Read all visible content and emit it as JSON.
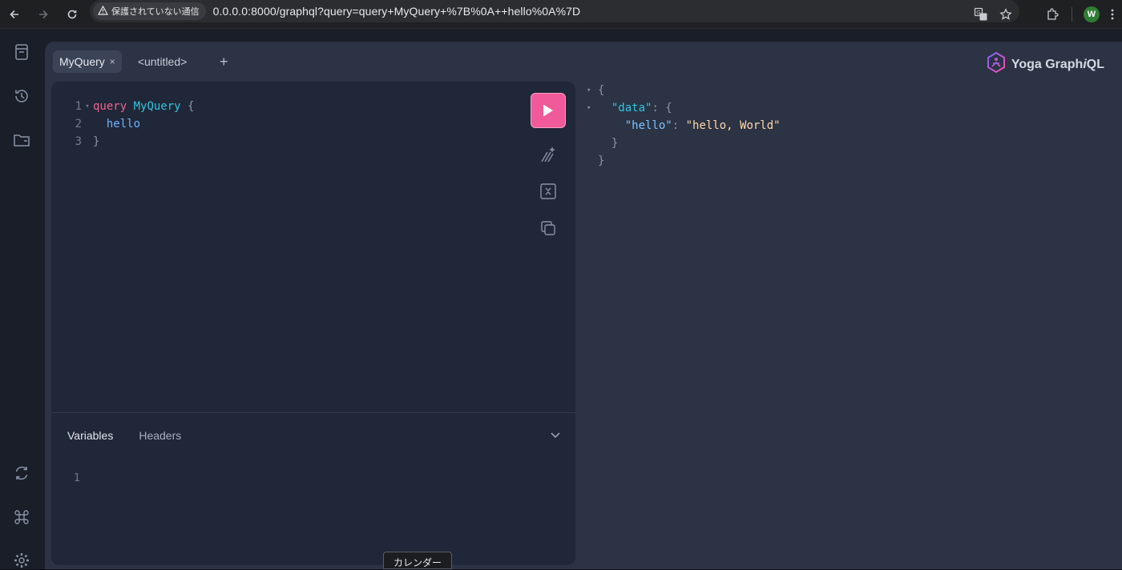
{
  "browser": {
    "security_label": "保護されていない通信",
    "url": "0.0.0.0:8000/graphql?query=query+MyQuery+%7B%0A++hello%0A%7D",
    "profile_initial": "W"
  },
  "tabs": [
    {
      "label": "MyQuery",
      "active": true,
      "close": "×"
    },
    {
      "label": "<untitled>",
      "active": false
    }
  ],
  "add_tab": "+",
  "brand": {
    "prefix": "Yoga Graph",
    "italic": "i",
    "suffix": "QL"
  },
  "editor": {
    "lines": [
      {
        "num": "1",
        "fold": "▾"
      },
      {
        "num": "2"
      },
      {
        "num": "3"
      }
    ],
    "tokens": {
      "keyword": "query",
      "op_name": "MyQuery",
      "open": "{",
      "field": "hello",
      "close": "}"
    }
  },
  "bottom_tabs": {
    "variables": "Variables",
    "headers": "Headers"
  },
  "variables_editor": {
    "line1": "1"
  },
  "result": {
    "open": "{",
    "data_key": "\"data\"",
    "colon": ": ",
    "data_open": "{",
    "hello_key": "\"hello\"",
    "hello_value": "\"hello, World\"",
    "data_close": "}",
    "close": "}"
  },
  "tooltip": "カレンダー",
  "colors": {
    "run_button": "#f0599a",
    "keyword": "#f06292",
    "name": "#2fc6e0",
    "string": "#ffd9a8"
  }
}
